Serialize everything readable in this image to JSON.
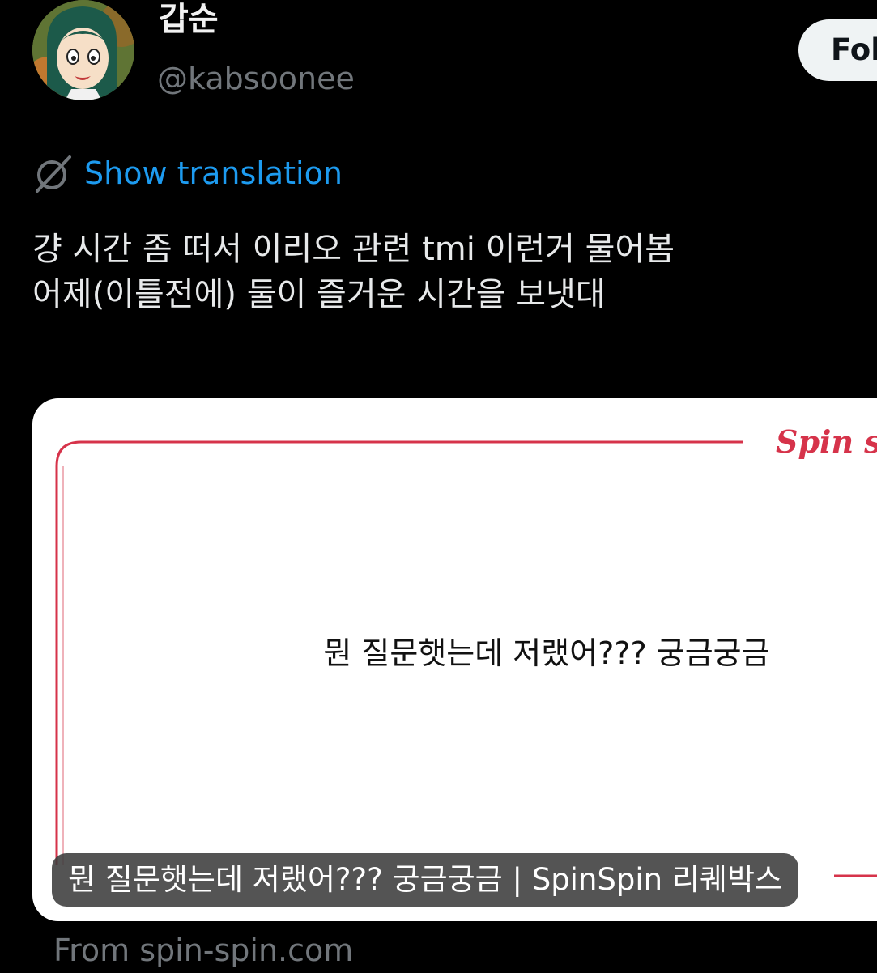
{
  "user": {
    "display_name": "갑순",
    "handle": "@kabsoonee",
    "follow_label": "Fol"
  },
  "translation": {
    "label": "Show translation"
  },
  "tweet": {
    "lines": [
      "걍 시간 좀 떠서 이리오 관련 tmi 이런거 물어봄",
      "어제(이틀전에) 둘이 즐거운 시간을 보냇대"
    ]
  },
  "card": {
    "brand": "Spin spin",
    "question": "뭔 질문햇는데 저랬어??? 궁금궁금",
    "caption": "뭔 질문햇는데 저랬어??? 궁금궁금 | SpinSpin 리퀘박스",
    "source": "From spin-spin.com"
  },
  "colors": {
    "background": "#000000",
    "link": "#1d9bf0",
    "muted": "#71767b",
    "brand": "#d6334a"
  },
  "icons": [
    "avatar-cartoon",
    "translate-globe-icon"
  ]
}
